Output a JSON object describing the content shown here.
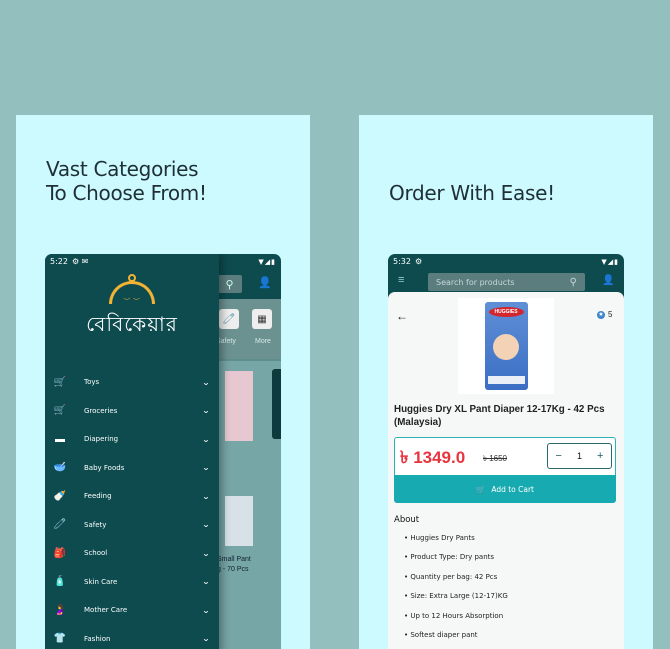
{
  "left_panel": {
    "headline_line1": "Vast Categories",
    "headline_line2": "To Choose From!",
    "status_time": "5:22",
    "status_icons": "⚙ ✉",
    "status_right": "▼◢▮",
    "logo_text": "বেবিকেয়ার",
    "underlay": {
      "cat_label_1": "Safety",
      "cat_label_2": "More",
      "product_text_1": "Small Pant",
      "product_text_2": "g - 70 Pcs"
    },
    "menu": [
      {
        "label": "Toys",
        "icon": "🛒"
      },
      {
        "label": "Groceries",
        "icon": "🛒"
      },
      {
        "label": "Diapering",
        "icon": "▬"
      },
      {
        "label": "Baby Foods",
        "icon": "🥣"
      },
      {
        "label": "Feeding",
        "icon": "🍼"
      },
      {
        "label": "Safety",
        "icon": "🧷"
      },
      {
        "label": "School",
        "icon": "🎒"
      },
      {
        "label": "Skin Care",
        "icon": "🧴"
      },
      {
        "label": "Mother Care",
        "icon": "🤰"
      },
      {
        "label": "Fashion",
        "icon": "👕"
      }
    ]
  },
  "right_panel": {
    "headline": "Order With Ease!",
    "status_time": "5:32",
    "status_icons": "⚙",
    "status_right": "▼◢▮",
    "search_placeholder": "Search for products",
    "rating": "5",
    "product_title": "Huggies Dry XL Pant Diaper 12-17Kg - 42 Pcs (Malaysia)",
    "price": "৳ 1349.0",
    "old_price": "৳ 1650",
    "quantity": "1",
    "add_to_cart": "Add to Cart",
    "about_heading": "About",
    "about_items": [
      "• Huggies Dry Pants",
      "• Product Type: Dry pants",
      "• Quantity per bag: 42 Pcs",
      "• Size: Extra Large (12-17)KG",
      "• Up to 12 Hours Absorption",
      "• Softest diaper pant"
    ]
  }
}
